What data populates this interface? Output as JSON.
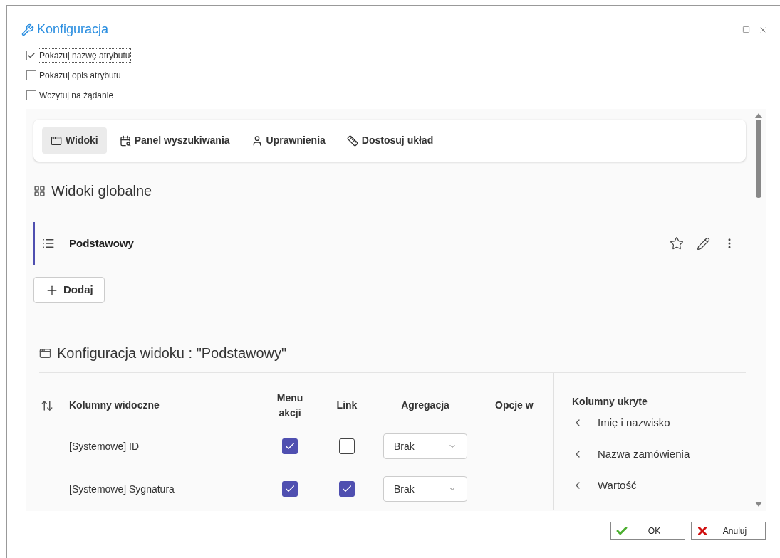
{
  "window": {
    "title": "Konfiguracja"
  },
  "options": [
    {
      "label": "Pokazuj nazwę atrybutu",
      "checked": true,
      "focused": true
    },
    {
      "label": "Pokazuj opis atrybutu",
      "checked": false,
      "focused": false
    },
    {
      "label": "Wczytuj na żądanie",
      "checked": false,
      "focused": false
    }
  ],
  "tabs": [
    {
      "label": "Widoki",
      "selected": true,
      "kind": "views"
    },
    {
      "label": "Panel wyszukiwania",
      "selected": false,
      "kind": "search"
    },
    {
      "label": "Uprawnienia",
      "selected": false,
      "kind": "person"
    },
    {
      "label": "Dostosuj układ",
      "selected": false,
      "kind": "layout"
    }
  ],
  "global_views": {
    "title": "Widoki globalne",
    "items": [
      {
        "name": "Podstawowy",
        "selected": true
      }
    ],
    "add_button": "Dodaj"
  },
  "view_config": {
    "title": "Konfiguracja widoku : \"Podstawowy\"",
    "columns": [
      "Kolumny widoczne",
      "Menu akcji",
      "Link",
      "Agregacja",
      "Opcje w"
    ],
    "rows": [
      {
        "name": "[Systemowe] ID",
        "menu": true,
        "link": false,
        "aggregation": "Brak"
      },
      {
        "name": "[Systemowe] Sygnatura",
        "menu": true,
        "link": true,
        "aggregation": "Brak"
      }
    ],
    "hidden_title": "Kolumny ukryte",
    "hidden": [
      "Imię i nazwisko",
      "Nazwa zamówienia",
      "Wartość"
    ]
  },
  "buttons": [
    {
      "label": "OK",
      "kind": "ok"
    },
    {
      "label": "Anuluj",
      "kind": "cancel"
    }
  ]
}
